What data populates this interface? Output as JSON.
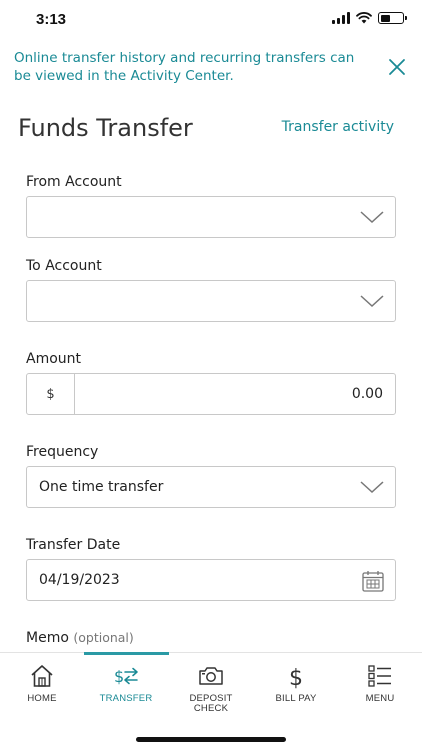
{
  "status_bar": {
    "time": "3:13"
  },
  "banner": {
    "message": "Online transfer history and recurring transfers can be viewed in the Activity Center."
  },
  "header": {
    "title": "Funds Transfer",
    "activity_link": "Transfer activity"
  },
  "form": {
    "from_account": {
      "label": "From Account",
      "value": ""
    },
    "to_account": {
      "label": "To Account",
      "value": ""
    },
    "amount": {
      "label": "Amount",
      "prefix": "$",
      "value": "0.00"
    },
    "frequency": {
      "label": "Frequency",
      "value": "One time transfer"
    },
    "transfer_date": {
      "label": "Transfer Date",
      "value": "04/19/2023"
    },
    "memo": {
      "label": "Memo",
      "optional": "(optional)"
    }
  },
  "bottom_nav": {
    "active": "transfer",
    "items": [
      {
        "id": "home",
        "label": "HOME",
        "icon": "home-icon"
      },
      {
        "id": "transfer",
        "label": "TRANSFER",
        "icon": "transfer-icon"
      },
      {
        "id": "deposit",
        "label": "DEPOSIT CHECK",
        "label_line1": "DEPOSIT",
        "label_line2": "CHECK",
        "icon": "camera-icon"
      },
      {
        "id": "billpay",
        "label": "BILL PAY",
        "icon": "dollar-icon"
      },
      {
        "id": "menu",
        "label": "MENU",
        "icon": "menu-icon"
      }
    ]
  },
  "colors": {
    "accent": "#1a8a95",
    "border": "#c8c8c8",
    "text": "#222222"
  }
}
